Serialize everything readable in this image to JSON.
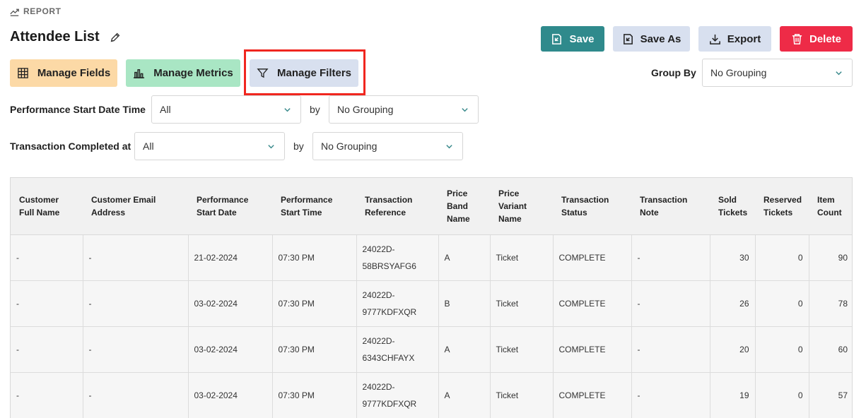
{
  "header": {
    "section_label": "REPORT",
    "title": "Attendee List"
  },
  "actions": {
    "save": "Save",
    "save_as": "Save As",
    "export": "Export",
    "delete": "Delete"
  },
  "manage": {
    "fields": "Manage Fields",
    "metrics": "Manage Metrics",
    "filters": "Manage Filters"
  },
  "group_by": {
    "label": "Group By",
    "value": "No Grouping"
  },
  "filters": [
    {
      "label": "Performance Start Date Time",
      "value": "All",
      "by": "by",
      "grouping": "No Grouping"
    },
    {
      "label": "Transaction Completed at",
      "value": "All",
      "by": "by",
      "grouping": "No Grouping"
    }
  ],
  "table": {
    "columns": [
      "Customer Full Name",
      "Customer Email Address",
      "Performance Start Date",
      "Performance Start Time",
      "Transaction Reference",
      "Price Band Name",
      "Price Variant Name",
      "Transaction Status",
      "Transaction Note",
      "Sold Tickets",
      "Reserved Tickets",
      "Item Count"
    ],
    "rows": [
      [
        "-",
        "-",
        "21-02-2024",
        "07:30 PM",
        "24022D-58BRSYAFG6",
        "A",
        "Ticket",
        "COMPLETE",
        "-",
        "30",
        "0",
        "90"
      ],
      [
        "-",
        "-",
        "03-02-2024",
        "07:30 PM",
        "24022D-9777KDFXQR",
        "B",
        "Ticket",
        "COMPLETE",
        "-",
        "26",
        "0",
        "78"
      ],
      [
        "-",
        "-",
        "03-02-2024",
        "07:30 PM",
        "24022D-6343CHFAYX",
        "A",
        "Ticket",
        "COMPLETE",
        "-",
        "20",
        "0",
        "60"
      ],
      [
        "-",
        "-",
        "03-02-2024",
        "07:30 PM",
        "24022D-9777KDFXQR",
        "A",
        "Ticket",
        "COMPLETE",
        "-",
        "19",
        "0",
        "57"
      ]
    ]
  },
  "colors": {
    "save": "#2f8a8c",
    "secondary": "#d8e0ef",
    "delete": "#ee2b47",
    "fields": "#fcd9a6",
    "metrics": "#a9e6c4",
    "highlight": "#f0261f",
    "chevron": "#3a8a8c"
  },
  "icons": {
    "report": "trend-chart-icon",
    "edit": "pencil-icon",
    "save": "save-icon",
    "save_as": "save-as-icon",
    "export": "download-icon",
    "delete": "trash-icon",
    "fields": "grid-icon",
    "metrics": "bar-chart-icon",
    "filters": "funnel-icon",
    "dropdown": "chevron-down-icon"
  }
}
